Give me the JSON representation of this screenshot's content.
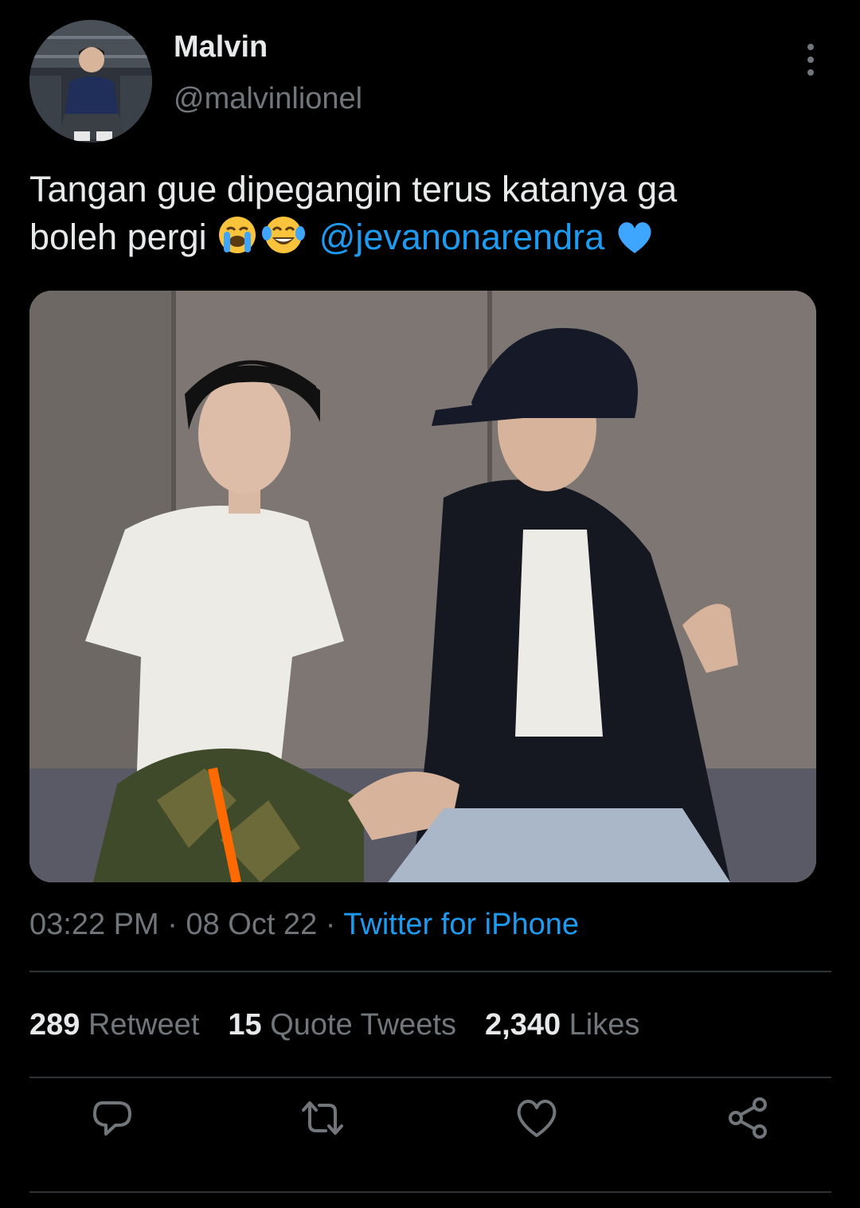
{
  "author": {
    "display_name": "Malvin",
    "handle": "@malvinlionel"
  },
  "tweet": {
    "text_line1": "Tangan gue dipegangin terus katanya ga",
    "text_line2": "boleh pergi",
    "emojis": [
      "loudly-crying-face",
      "face-with-tears-of-joy",
      "blue-heart"
    ],
    "mention": "@jevanonarendra"
  },
  "meta": {
    "time": "03:22 PM",
    "separator": "·",
    "date": "08 Oct 22",
    "source": "Twitter for iPhone"
  },
  "stats": {
    "retweets_count": "289",
    "retweets_label": "Retweet",
    "quotes_count": "15",
    "quotes_label": "Quote Tweets",
    "likes_count": "2,340",
    "likes_label": "Likes"
  },
  "actions": [
    "reply-icon",
    "retweet-icon",
    "like-icon",
    "share-icon"
  ],
  "colors": {
    "background": "#000000",
    "text": "#e7e9ea",
    "secondary": "#71767b",
    "link": "#1d9bf0",
    "divider": "#2f3336"
  }
}
